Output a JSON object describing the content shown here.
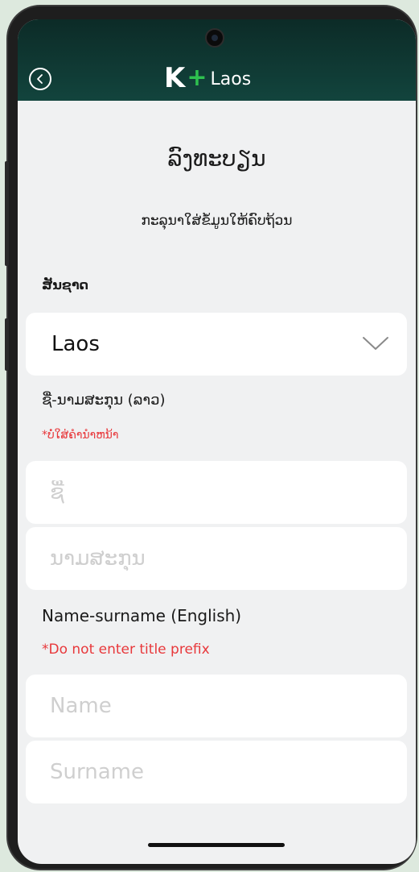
{
  "header": {
    "logo_k": "K",
    "logo_plus": "+",
    "logo_text": "Laos"
  },
  "page": {
    "title": "ລົງທະບຽນ",
    "subtitle": "ກະລຸນາໃສ່ຂໍ້ມູນໃຫ້ຄົບຖ້ວນ"
  },
  "nationality": {
    "label": "ສັນຊາດ",
    "selected": "Laos"
  },
  "lao_name": {
    "label": "ຊື່-ນາມສະກຸນ (ລາວ)",
    "warning": "*ບໍ່ໃສ່ຄຳນຳຫນ້າ",
    "first_placeholder": "ຊື່",
    "last_placeholder": "ນາມສະກຸນ"
  },
  "english_name": {
    "label": "Name-surname (English)",
    "warning": "*Do not enter title prefix",
    "first_placeholder": "Name",
    "last_placeholder": "Surname"
  },
  "colors": {
    "header_bg": "#0c2b27",
    "brand_green": "#2ec04f",
    "warning_red": "#e8383b",
    "screen_bg": "#f0f1f2"
  },
  "icons": [
    "back-arrow-icon",
    "chevron-down-icon",
    "camera-icon"
  ]
}
